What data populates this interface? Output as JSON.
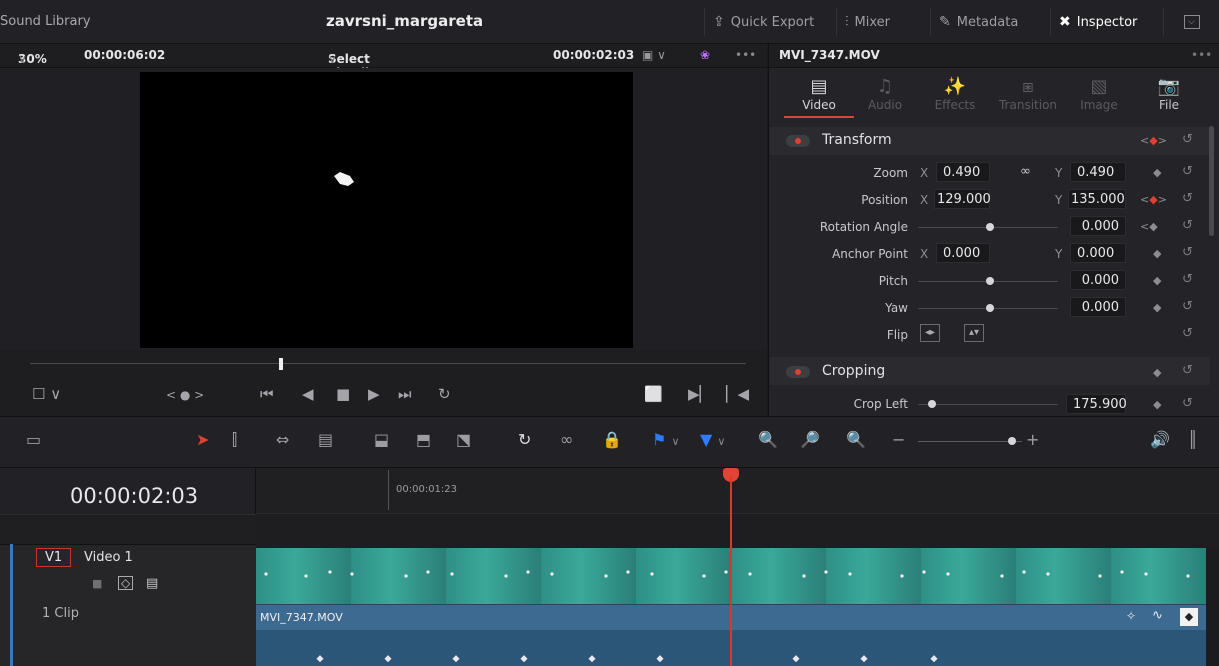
{
  "topbar": {
    "library": "Sound Library",
    "project_title": "zavrsni_margareta",
    "quick_export": "Quick Export",
    "mixer": "Mixer",
    "metadata": "Metadata",
    "inspector": "Inspector"
  },
  "viewer": {
    "zoom": "30%",
    "source_tc": "00:00:06:02",
    "timeline_select": "Select Timeline",
    "timecode": "00:00:02:03"
  },
  "inspector": {
    "clip_name": "MVI_7347.MOV",
    "tabs": [
      {
        "label": "Video",
        "icon": "film-icon",
        "active": true
      },
      {
        "label": "Audio",
        "icon": "music-icon",
        "active": false
      },
      {
        "label": "Effects",
        "icon": "wand-icon",
        "active": false
      },
      {
        "label": "Transition",
        "icon": "transition-icon",
        "active": false
      },
      {
        "label": "Image",
        "icon": "image-icon",
        "active": false
      },
      {
        "label": "File",
        "icon": "file-icon",
        "active": false
      }
    ],
    "transform": {
      "title": "Transform",
      "zoom_label": "Zoom",
      "zoom_x": "0.490",
      "zoom_y": "0.490",
      "position_label": "Position",
      "position_x": "129.000",
      "position_y": "135.000",
      "rotation_label": "Rotation Angle",
      "rotation": "0.000",
      "anchor_label": "Anchor Point",
      "anchor_x": "0.000",
      "anchor_y": "0.000",
      "pitch_label": "Pitch",
      "pitch": "0.000",
      "yaw_label": "Yaw",
      "yaw": "0.000",
      "flip_label": "Flip",
      "axis_x": "X",
      "axis_y": "Y"
    },
    "cropping": {
      "title": "Cropping",
      "crop_left_label": "Crop Left",
      "crop_left": "175.900"
    }
  },
  "timeline": {
    "current_tc": "00:00:02:03",
    "ruler_tc": "00:00:01:23",
    "track_id": "V1",
    "track_name": "Video 1",
    "clip_count": "1 Clip",
    "clip_name": "MVI_7347.MOV"
  },
  "colors": {
    "accent": "#d8473a",
    "clip_blue": "#3c6a90",
    "clip_teal": "#3aa89a"
  }
}
